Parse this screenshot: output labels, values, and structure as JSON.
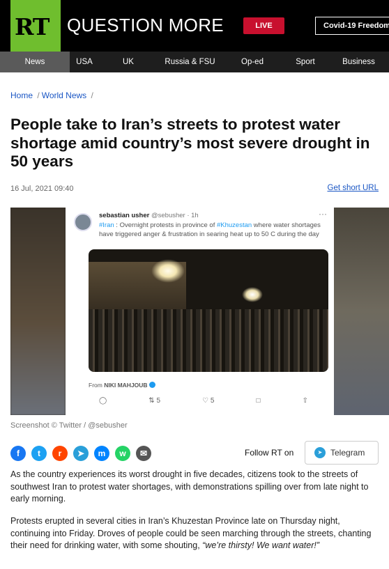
{
  "header": {
    "logo_text": "RT",
    "brand": "QUESTION MORE",
    "live_label": "LIVE",
    "covid_link": "Covid-19 Freedom"
  },
  "nav": {
    "items": [
      "News",
      "USA",
      "UK",
      "Russia & FSU",
      "Op-ed",
      "Sport",
      "Business"
    ],
    "active": "News"
  },
  "breadcrumb": {
    "home": "Home",
    "section": "World News",
    "separator": "/"
  },
  "article": {
    "title": "People take to Iran’s streets to protest water shortage amid country’s most severe drought in 50 years",
    "date": "16 Jul, 2021 09:40",
    "short_url_label": "Get short URL",
    "image_caption": "Screenshot © Twitter / @sebusher",
    "paragraph1": "As the country experiences its worst drought in five decades, citizens took to the streets of southwest Iran to protest water shortages, with demonstrations spilling over from late night to early morning.",
    "paragraph2_prefix": "Protests erupted in several cities in Iran’s Khuzestan Province late on Thursday night, continuing into Friday. Droves of people could be seen marching through the streets, chanting their need for drinking water, with some shouting, ",
    "paragraph2_quote": "“we’re thirsty! We want water!”"
  },
  "tweet": {
    "name": "sebastian usher",
    "handle": "@sebusher · 1h",
    "hashtag1": "#Iran",
    "text_part1": " : Overnight protests in province of ",
    "hashtag2": "#Khuzestan",
    "text_part2": " where water shortages have triggered anger & frustration in searing heat up to 50 C during the day",
    "from_label": "From",
    "from_name": "NIKI MAHJOUB",
    "retweets": "5",
    "likes": "5"
  },
  "share": {
    "icons": [
      "facebook-icon",
      "twitter-icon",
      "reddit-icon",
      "telegram-icon",
      "messenger-icon",
      "whatsapp-icon",
      "email-icon"
    ],
    "colors": {
      "facebook": "#1877f2",
      "twitter": "#1da1f2",
      "reddit": "#ff4500",
      "telegram": "#2a9fd9",
      "messenger": "#0084ff",
      "whatsapp": "#25d366",
      "email": "#555555"
    },
    "follow_label": "Follow RT on",
    "telegram_button": "Telegram"
  },
  "colors": {
    "brand_green": "#6fbe2e",
    "live_red": "#c8102e",
    "link_blue": "#1a56c4"
  }
}
